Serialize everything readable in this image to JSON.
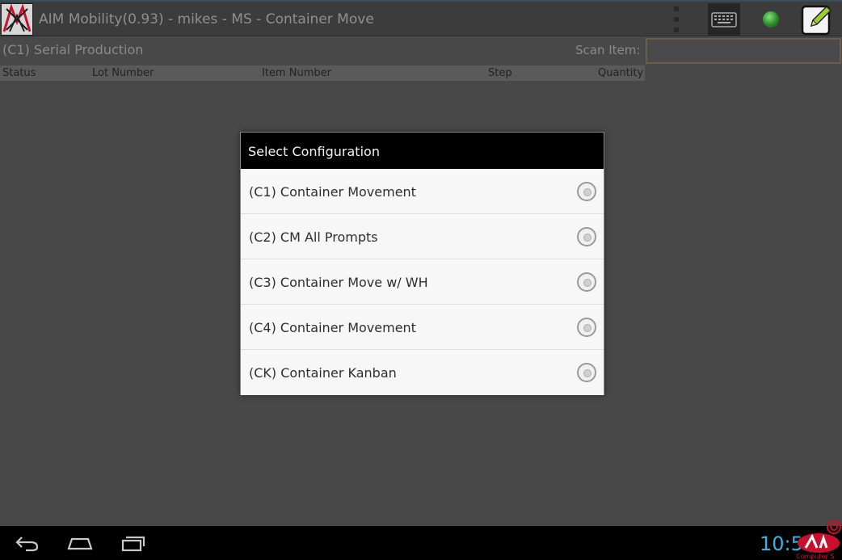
{
  "app": {
    "title": "AIM Mobility(0.93) - mikes - MS - Container Move",
    "logo_icon": "aim-logo-icon",
    "menu_icon": "overflow-menu-icon",
    "keyboard_icon": "keyboard-icon",
    "status_icon": "status-dot-icon",
    "status_color": "#2e9c2e",
    "edit_icon": "edit-notes-icon"
  },
  "subheader": {
    "config_title": "(C1) Serial Production",
    "scan_label": "Scan Item:",
    "scan_value": ""
  },
  "table": {
    "columns": [
      "Status",
      "Lot Number",
      "Item Number",
      "Step",
      "Quantity"
    ],
    "rows": []
  },
  "dialog": {
    "title": "Select Configuration",
    "options": [
      {
        "label": "(C1) Container Movement",
        "selected": false
      },
      {
        "label": "(C2) CM All Prompts",
        "selected": false
      },
      {
        "label": "(C3) Container Move w/ WH",
        "selected": false
      },
      {
        "label": "(C4) Container Movement",
        "selected": false
      },
      {
        "label": "(CK) Container Kanban",
        "selected": false
      }
    ]
  },
  "system_bar": {
    "back_icon": "back-icon",
    "home_icon": "home-icon",
    "recents_icon": "recent-apps-icon",
    "clock": "10:5",
    "accent_color": "#33b5e5"
  },
  "watermark": {
    "logo_icon": "company-logo-icon",
    "text": "Computer S"
  }
}
